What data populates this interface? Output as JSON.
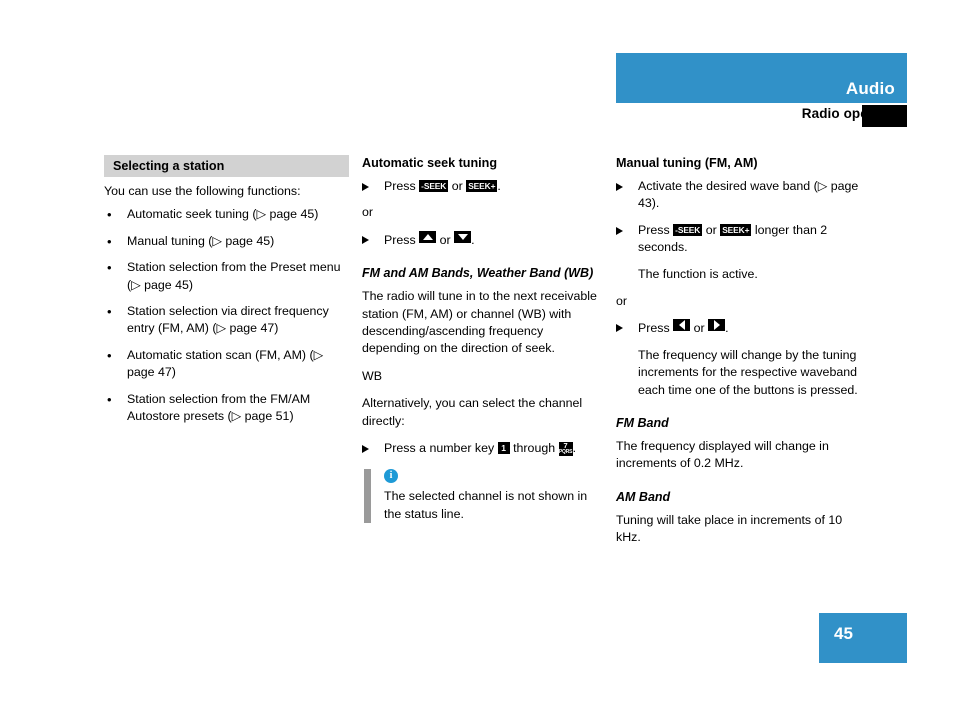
{
  "header": {
    "title": "Audio",
    "subtitle": "Radio operation"
  },
  "footer": {
    "page_number": "45"
  },
  "colors": {
    "accent_blue": "#3191c8",
    "info_blue": "#1e9ad6",
    "section_gray": "#d2d2d2",
    "note_bar_gray": "#9a9a9a"
  },
  "column_left": {
    "section_heading": "Selecting a station",
    "intro": "You can use the following functions:",
    "bullets": [
      "Automatic seek tuning (▷ page 45)",
      "Manual tuning (▷ page 45)",
      "Station selection from the Preset menu (▷ page 45)",
      "Station selection via direct frequency entry (FM, AM) (▷ page 47)",
      "Automatic station scan (FM, AM) (▷ page 47)",
      "Station selection from the FM/AM Autostore presets (▷ page 51)"
    ]
  },
  "column_middle": {
    "heading": "Automatic seek tuning",
    "step1_press": "Press",
    "step1_or": "or",
    "step1_end": ".",
    "key_seek_minus": "-SEEK",
    "key_seek_plus": "SEEK+",
    "or_label": "or",
    "step2_press": "Press",
    "step2_or": "or",
    "step2_end": ".",
    "subheading": "FM and AM Bands, Weather Band (WB)",
    "paragraph1": "The radio will tune in to the next receivable station (FM, AM) or channel (WB) with descending/ascending frequency depending on the direction of seek.",
    "wb_label": "WB",
    "paragraph2": "Alternatively, you can select the channel directly:",
    "step3_pre": "Press a number key",
    "step3_mid": "through",
    "step3_end": ".",
    "key_num_1": "1",
    "key_num_7": "7",
    "key_num_7_letters": "PQRS",
    "note": {
      "icon": "info-icon",
      "text": "The selected channel is not shown in the status line."
    }
  },
  "column_right": {
    "heading": "Manual tuning (FM, AM)",
    "step1": "Activate the desired wave band (▷ page 43).",
    "step2_pre": "Press",
    "step2_or": "or",
    "step2_post": "longer than 2 seconds.",
    "key_seek_minus": "-SEEK",
    "key_seek_plus": "SEEK+",
    "step2_result": "The function is active.",
    "or_label": "or",
    "step3_pre": "Press",
    "step3_or": "or",
    "step3_end": ".",
    "step3_result": "The frequency will change by the tuning increments for the respective waveband each time one of the buttons is pressed.",
    "fm_heading": "FM Band",
    "fm_text": "The frequency displayed will change in increments of 0.2 MHz.",
    "am_heading": "AM Band",
    "am_text": "Tuning will take place in increments of 10 kHz."
  }
}
